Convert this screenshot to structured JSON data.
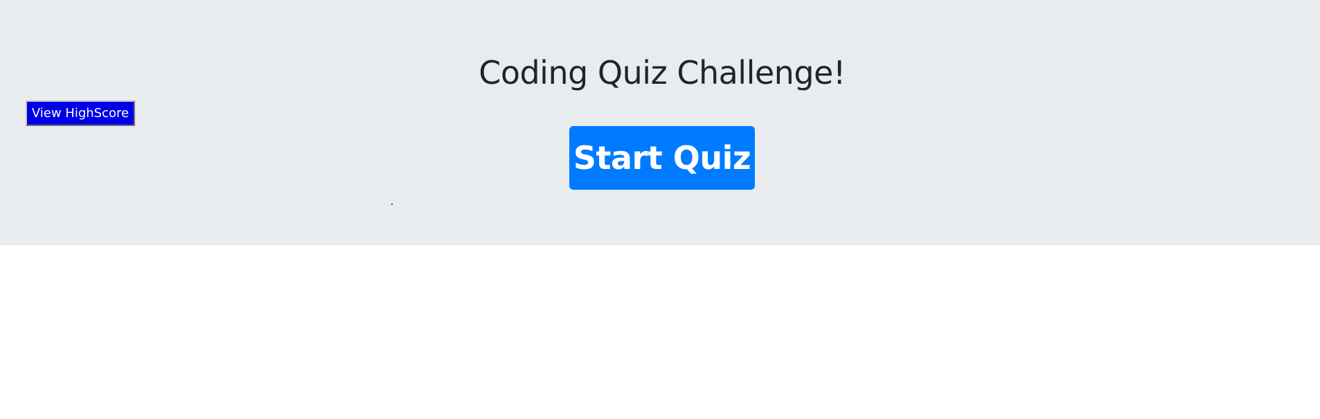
{
  "header": {
    "title": "Coding Quiz Challenge!"
  },
  "controls": {
    "view_highscore_label": "View HighScore",
    "start_quiz_label": "Start Quiz"
  },
  "colors": {
    "jumbotron_bg": "#e9ecef",
    "start_button_bg": "#007bff",
    "highscore_button_bg": "#0000e6",
    "title_text": "#212529"
  }
}
